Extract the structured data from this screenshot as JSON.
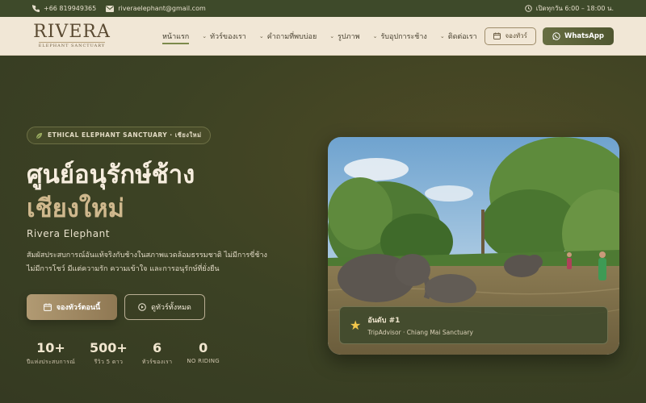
{
  "topbar": {
    "phone": "+66 819949365",
    "email": "riveraelephant@gmail.com",
    "hours": "เปิดทุกวัน 6:00 – 18:00 น."
  },
  "brand": {
    "name": "RIVERA",
    "tagline": "ELEPHANT SANCTUARY"
  },
  "nav": {
    "items": [
      {
        "label": "หน้าแรก",
        "active": true,
        "dropdown": false
      },
      {
        "label": "ทัวร์ของเรา",
        "active": false,
        "dropdown": true
      },
      {
        "label": "คำถามที่พบบ่อย",
        "active": false,
        "dropdown": true
      },
      {
        "label": "รูปภาพ",
        "active": false,
        "dropdown": true
      },
      {
        "label": "รับอุปการะช้าง",
        "active": false,
        "dropdown": true
      },
      {
        "label": "ติดต่อเรา",
        "active": false,
        "dropdown": true
      }
    ],
    "book_label": "จองทัวร์",
    "whatsapp_label": "WhatsApp"
  },
  "hero": {
    "badge": "ETHICAL ELEPHANT SANCTUARY · เชียงใหม่",
    "title_line1": "ศูนย์อนุรักษ์ช้าง",
    "title_line2": "เชียงใหม่",
    "subtitle": "Rivera Elephant",
    "description_line1": "สัมผัสประสบการณ์อันแท้จริงกับช้างในสภาพแวดล้อมธรรมชาติ ไม่มีการขี่ช้าง",
    "description_line2": "ไม่มีการโชว์ มีแต่ความรัก ความเข้าใจ และการอนุรักษ์ที่ยั่งยืน",
    "primary_cta": "จองทัวร์ตอนนี้",
    "secondary_cta": "ดูทัวร์ทั้งหมด"
  },
  "stats": [
    {
      "value": "10+",
      "label": "ปีแห่งประสบการณ์"
    },
    {
      "value": "500+",
      "label": "รีวิว 5 ดาว"
    },
    {
      "value": "6",
      "label": "ทัวร์ของเรา"
    },
    {
      "value": "0",
      "label": "NO RIDING"
    }
  ],
  "award": {
    "title": "อันดับ #1",
    "subtitle": "TripAdvisor · Chiang Mai Sanctuary"
  },
  "colors": {
    "topbar_bg": "#3e4a2a",
    "nav_bg": "#f1e7d6",
    "hero_bg": "#3a3f23",
    "accent_gold": "#cfb88d",
    "whatsapp_btn": "#5b6237"
  }
}
